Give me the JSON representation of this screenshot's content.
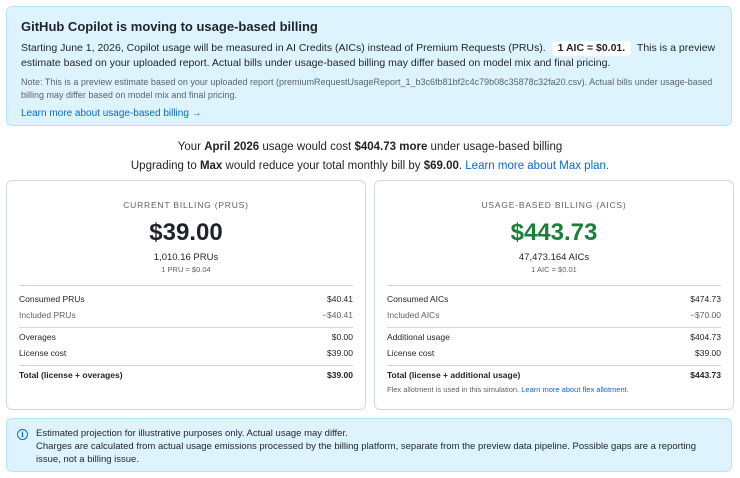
{
  "banner": {
    "title": "GitHub Copilot is moving to usage-based billing",
    "text_before": "Starting June 1, 2026, Copilot usage will be measured in AI Credits (AICs) instead of Premium Requests (PRUs).",
    "pill": "1 AIC = $0.01.",
    "text_after": "This is a preview estimate based on your uploaded report. Actual bills under usage-based billing may differ based on model mix and final pricing.",
    "note": "Note: This is a preview estimate based on your uploaded report (premiumRequestUsageReport_1_b3c6fb81bf2c4c79b08c35878c32fa20.csv). Actual bills under usage-based billing may differ based on model mix and final pricing.",
    "link": "Learn more about usage-based billing →"
  },
  "summary": {
    "line1_a": "Your",
    "month": "April 2026",
    "line1_b": "usage would cost",
    "amount": "$404.73 more",
    "line1_c": "under usage-based billing",
    "line2_a": "Upgrading to",
    "plan": "Max",
    "line2_b": "would reduce your total monthly bill by",
    "savings": "$69.00",
    "line2_c": ".",
    "link": "Learn more about Max plan."
  },
  "current": {
    "label": "CURRENT BILLING (PRUS)",
    "amount": "$39.00",
    "units": "1,010.16 PRUs",
    "rate": "1 PRU = $0.04",
    "rows": [
      {
        "label": "Consumed PRUs",
        "value": "$40.41"
      },
      {
        "label": "Included PRUs",
        "value": "−$40.41"
      },
      {
        "label": "Overages",
        "value": "$0.00"
      },
      {
        "label": "License cost",
        "value": "$39.00"
      },
      {
        "label": "Total (license + overages)",
        "value": "$39.00"
      }
    ]
  },
  "usage": {
    "label": "USAGE-BASED BILLING (AICS)",
    "amount": "$443.73",
    "units": "47,473.164 AICs",
    "rate": "1 AIC = $0.01",
    "rows": [
      {
        "label": "Consumed AICs",
        "value": "$474.73"
      },
      {
        "label": "Included AICs",
        "value": "−$70.00"
      },
      {
        "label": "Additional usage",
        "value": "$404.73"
      },
      {
        "label": "License cost",
        "value": "$39.00"
      },
      {
        "label": "Total (license + additional usage)",
        "value": "$443.73"
      }
    ],
    "flex_note": "Flex allotment is used in this simulation.",
    "flex_link": "Learn more about flex allotment."
  },
  "info": {
    "icon": "info-icon",
    "line1": "Estimated projection for illustrative purposes only. Actual usage may differ.",
    "line2": "Charges are calculated from actual usage emissions processed by the billing platform, separate from the preview data pipeline. Possible gaps are a reporting issue, not a billing issue."
  },
  "colors": {
    "accent": "#0969da",
    "banner_bg": "#ddf4ff",
    "green": "#1a7f37"
  }
}
